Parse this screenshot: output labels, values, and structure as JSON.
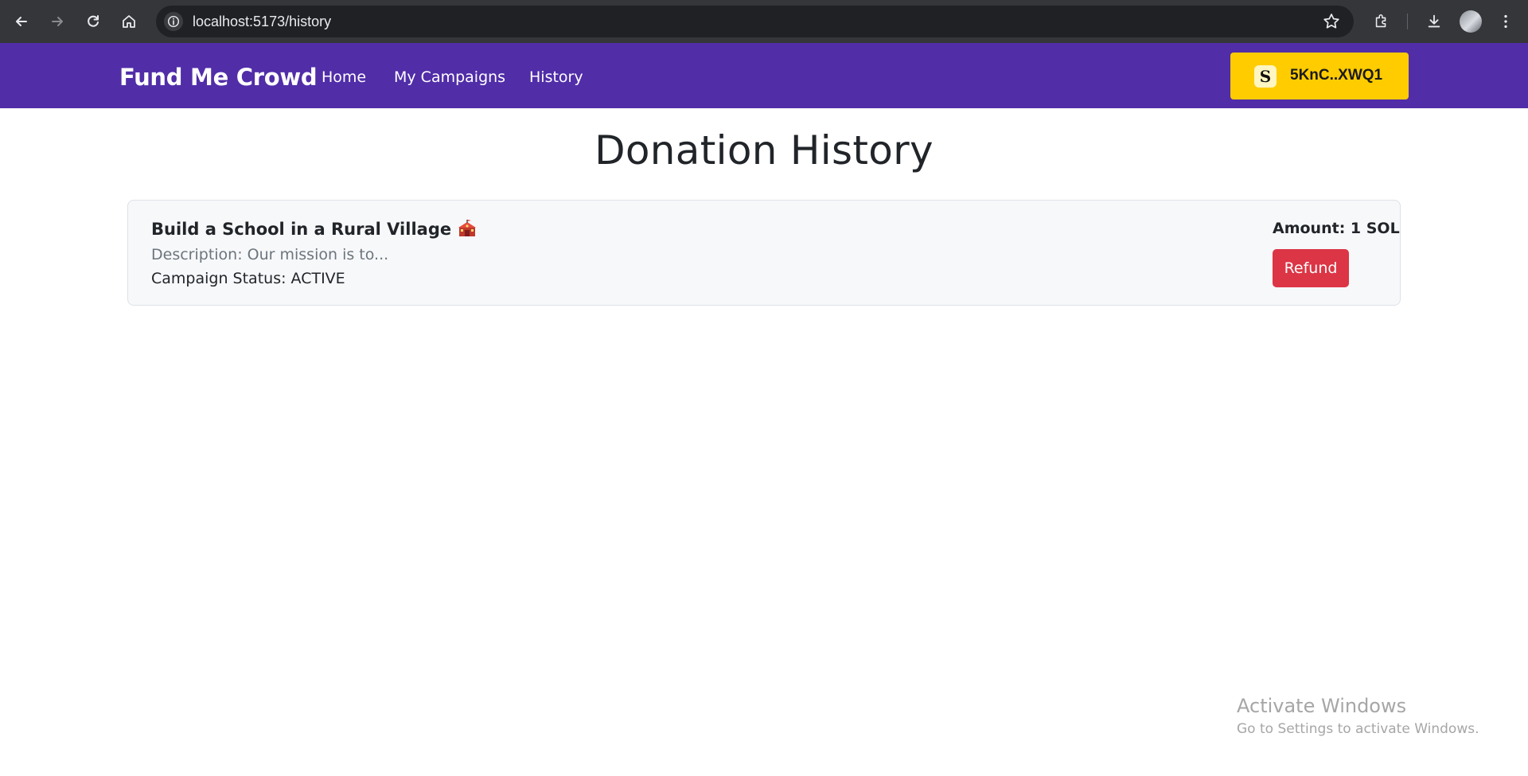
{
  "browser": {
    "url": "localhost:5173/history"
  },
  "navbar": {
    "brand": "Fund Me Crowd",
    "links": [
      {
        "label": "Home"
      },
      {
        "label": "My Campaigns"
      },
      {
        "label": "History"
      }
    ],
    "wallet": {
      "icon": "solana-s-icon",
      "icon_glyph": "S",
      "label": "5KnC..XWQ1"
    },
    "background_color": "#512da8",
    "wallet_color": "#ffcc00"
  },
  "page": {
    "title": "Donation History"
  },
  "donations": [
    {
      "campaign_title": "Build a School in a Rural Village",
      "title_icon": "school-emoji-icon",
      "description": "Description: Our mission is to...",
      "status": "Campaign Status: ACTIVE",
      "amount": "Amount: 1 SOL",
      "action_label": "Refund",
      "action_color": "#dc3545"
    }
  ],
  "watermark": {
    "title": "Activate Windows",
    "subtitle": "Go to Settings to activate Windows."
  }
}
